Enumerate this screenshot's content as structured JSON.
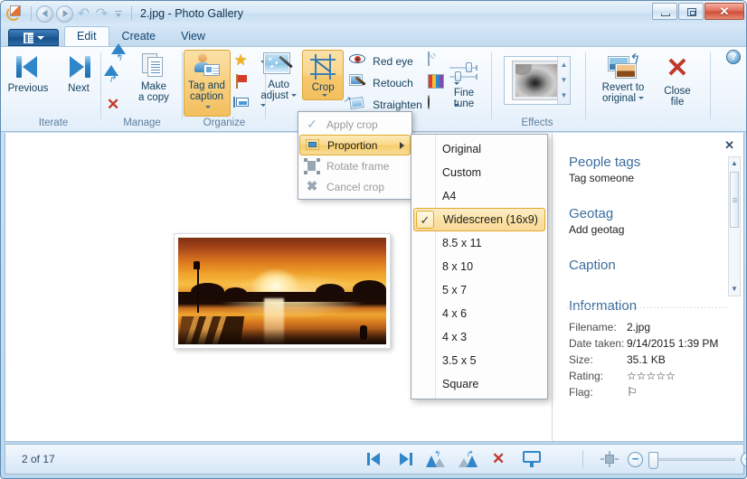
{
  "window": {
    "title": "2.jpg - Photo Gallery",
    "app_icon": "photo-gallery-icon",
    "minimize_label": "",
    "maximize_label": "",
    "close_label": "✕"
  },
  "quick_access": {
    "back": "back-arrow",
    "forward": "forward-arrow",
    "undo": "↶",
    "redo": "↷",
    "customize": "customize-quick-access"
  },
  "ribbon": {
    "app_button": "file-menu",
    "help_label": "?",
    "tabs": [
      {
        "label": "Edit",
        "active": true
      },
      {
        "label": "Create",
        "active": false
      },
      {
        "label": "View",
        "active": false
      }
    ],
    "groups": [
      {
        "name": "Iterate",
        "label": "Iterate",
        "buttons": [
          {
            "label": "Previous",
            "icon": "skip-previous-icon"
          },
          {
            "label": "Next",
            "icon": "skip-next-icon"
          }
        ]
      },
      {
        "name": "Manage",
        "label": "Manage",
        "buttons": [
          {
            "label": "Make\na copy",
            "line1": "Make",
            "line2": "a copy",
            "icon": "copy-icon"
          }
        ],
        "small_buttons": [
          {
            "label": "",
            "icon": "rotate-left-icon"
          },
          {
            "label": "",
            "icon": "rotate-right-icon"
          },
          {
            "label": "",
            "icon": "delete-icon"
          }
        ]
      },
      {
        "name": "Organize",
        "label": "Organize",
        "buttons": [
          {
            "line1": "Tag and",
            "line2": "caption",
            "icon": "tag-caption-icon",
            "active": true,
            "has_dropdown": true
          }
        ],
        "small_buttons": [
          {
            "icon": "star-rating-icon",
            "has_dropdown": true
          },
          {
            "icon": "flag-icon",
            "has_dropdown": false
          },
          {
            "icon": "caption-icon",
            "has_dropdown": true
          }
        ]
      },
      {
        "name": "Adjustments",
        "label": "",
        "buttons": [
          {
            "line1": "Auto",
            "line2": "adjust",
            "icon": "auto-adjust-icon",
            "has_dropdown": true
          },
          {
            "label": "Crop",
            "icon": "crop-icon",
            "active": true,
            "has_dropdown": true
          }
        ],
        "small_buttons": [
          {
            "label": "Red eye",
            "icon": "red-eye-icon"
          },
          {
            "label": "Retouch",
            "icon": "retouch-icon"
          },
          {
            "label": "Straighten",
            "icon": "straighten-icon"
          }
        ],
        "tiny_buttons": [
          {
            "icon": "exposure-icon",
            "has_dropdown": false
          },
          {
            "icon": "color-icon",
            "has_dropdown": true
          },
          {
            "icon": "contrast-icon",
            "has_dropdown": true
          }
        ],
        "fine_tune": {
          "line1": "Fine",
          "line2": "tune",
          "icon": "fine-tune-icon"
        }
      },
      {
        "name": "Effects",
        "label": "Effects",
        "gallery_thumb": "effect-thumbnail",
        "scroll_up": "▲",
        "scroll_down": "▼",
        "scroll_more": "▼"
      },
      {
        "name": "File",
        "label": "",
        "buttons": [
          {
            "line1": "Revert to",
            "line2": "original",
            "icon": "revert-icon",
            "has_dropdown": true
          },
          {
            "line1": "Close",
            "line2": "file",
            "icon": "close-file-icon"
          }
        ]
      }
    ]
  },
  "crop_menu": {
    "items": [
      {
        "label": "Apply crop",
        "accel": "A",
        "icon": "check-icon",
        "enabled": false,
        "highlighted": false,
        "has_submenu": false
      },
      {
        "label": "Proportion",
        "accel": "r",
        "icon": "proportion-icon",
        "enabled": true,
        "highlighted": true,
        "has_submenu": true
      },
      {
        "label": "Rotate frame",
        "accel": "f",
        "icon": "rotate-frame-icon",
        "enabled": false,
        "highlighted": false,
        "has_submenu": false
      },
      {
        "label": "Cancel crop",
        "accel": "C",
        "icon": "cancel-crop-icon",
        "enabled": false,
        "highlighted": false,
        "has_submenu": false
      }
    ]
  },
  "proportion_submenu": {
    "items": [
      {
        "label": "Original",
        "selected": false
      },
      {
        "label": "Custom",
        "selected": false
      },
      {
        "label": "A4",
        "selected": false
      },
      {
        "label": "Widescreen (16x9)",
        "selected": true,
        "check": "✓"
      },
      {
        "label": "8.5 x 11",
        "selected": false
      },
      {
        "label": "8 x 10",
        "selected": false
      },
      {
        "label": "5 x 7",
        "selected": false
      },
      {
        "label": "4 x 6",
        "selected": false
      },
      {
        "label": "4 x 3",
        "selected": false
      },
      {
        "label": "3.5 x 5",
        "selected": false
      },
      {
        "label": "Square",
        "selected": false
      }
    ]
  },
  "info_panel": {
    "close_label": "✕",
    "people_tags": {
      "heading": "People tags",
      "action": "Tag someone"
    },
    "geotag": {
      "heading": "Geotag",
      "action": "Add geotag"
    },
    "caption": {
      "heading": "Caption"
    },
    "information": {
      "heading": "Information",
      "rows": [
        {
          "key": "Filename:",
          "value": "2.jpg"
        },
        {
          "key": "Date taken:",
          "value": "9/14/2015  1:39 PM"
        },
        {
          "key": "Size:",
          "value": "35.1 KB"
        },
        {
          "key": "Rating:",
          "value": "☆☆☆☆☆"
        },
        {
          "key": "Flag:",
          "value": "⚐"
        }
      ]
    },
    "scroll_up": "▲",
    "scroll_down": "▼"
  },
  "status_bar": {
    "count": "2 of 17",
    "tools": [
      {
        "name": "previous-image",
        "icon": "skip-previous-icon"
      },
      {
        "name": "next-image",
        "icon": "skip-next-icon"
      },
      {
        "name": "rotate-counterclockwise",
        "icon": "rotate-left-icon"
      },
      {
        "name": "rotate-clockwise",
        "icon": "rotate-right-icon"
      },
      {
        "name": "delete-image",
        "icon": "delete-icon"
      },
      {
        "name": "play-slideshow",
        "icon": "slideshow-icon"
      }
    ],
    "fit_to_window": "fit-to-window-icon",
    "zoom_out": "−",
    "zoom_in": "+",
    "zoom_value": "0"
  },
  "photo": {
    "alt": "sunset-over-lake-photo"
  },
  "colors": {
    "accent_orange": "#f0b323",
    "highlight_border": "#e0a92b",
    "ribbon_blue": "#3b6e9e",
    "title_text": "#10334f",
    "delete_red": "#c0392b"
  }
}
